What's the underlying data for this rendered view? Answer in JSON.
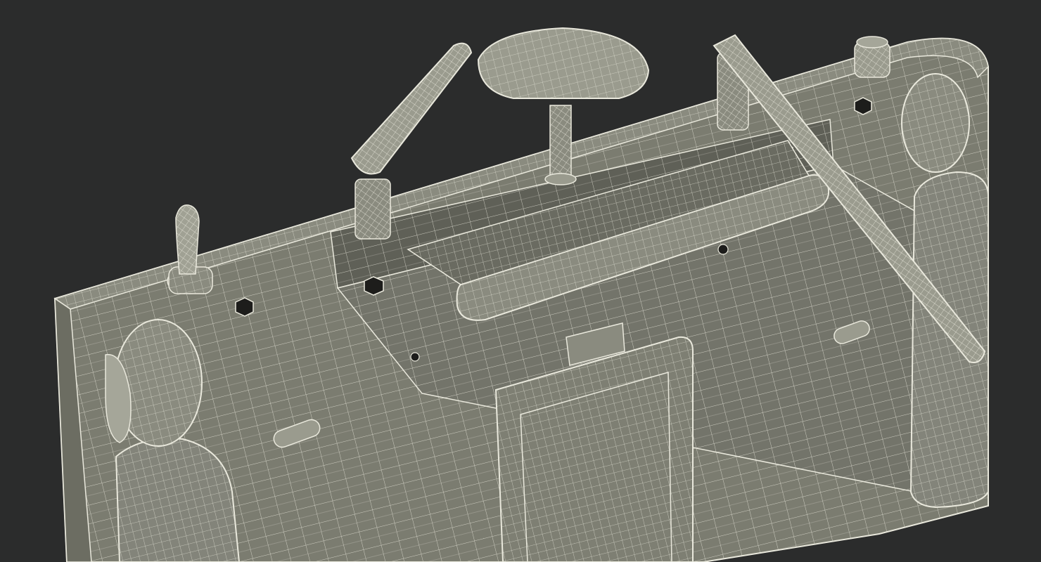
{
  "scene": {
    "subject": "wireframe-render-remote-controller-back",
    "colors": {
      "background": "#2b2c2c",
      "surface": "#7b7c70",
      "surface_light": "#8a8b7f",
      "surface_dark": "#4f5049",
      "wire": "#e9e8dc",
      "hole": "#1d1d1b"
    }
  }
}
